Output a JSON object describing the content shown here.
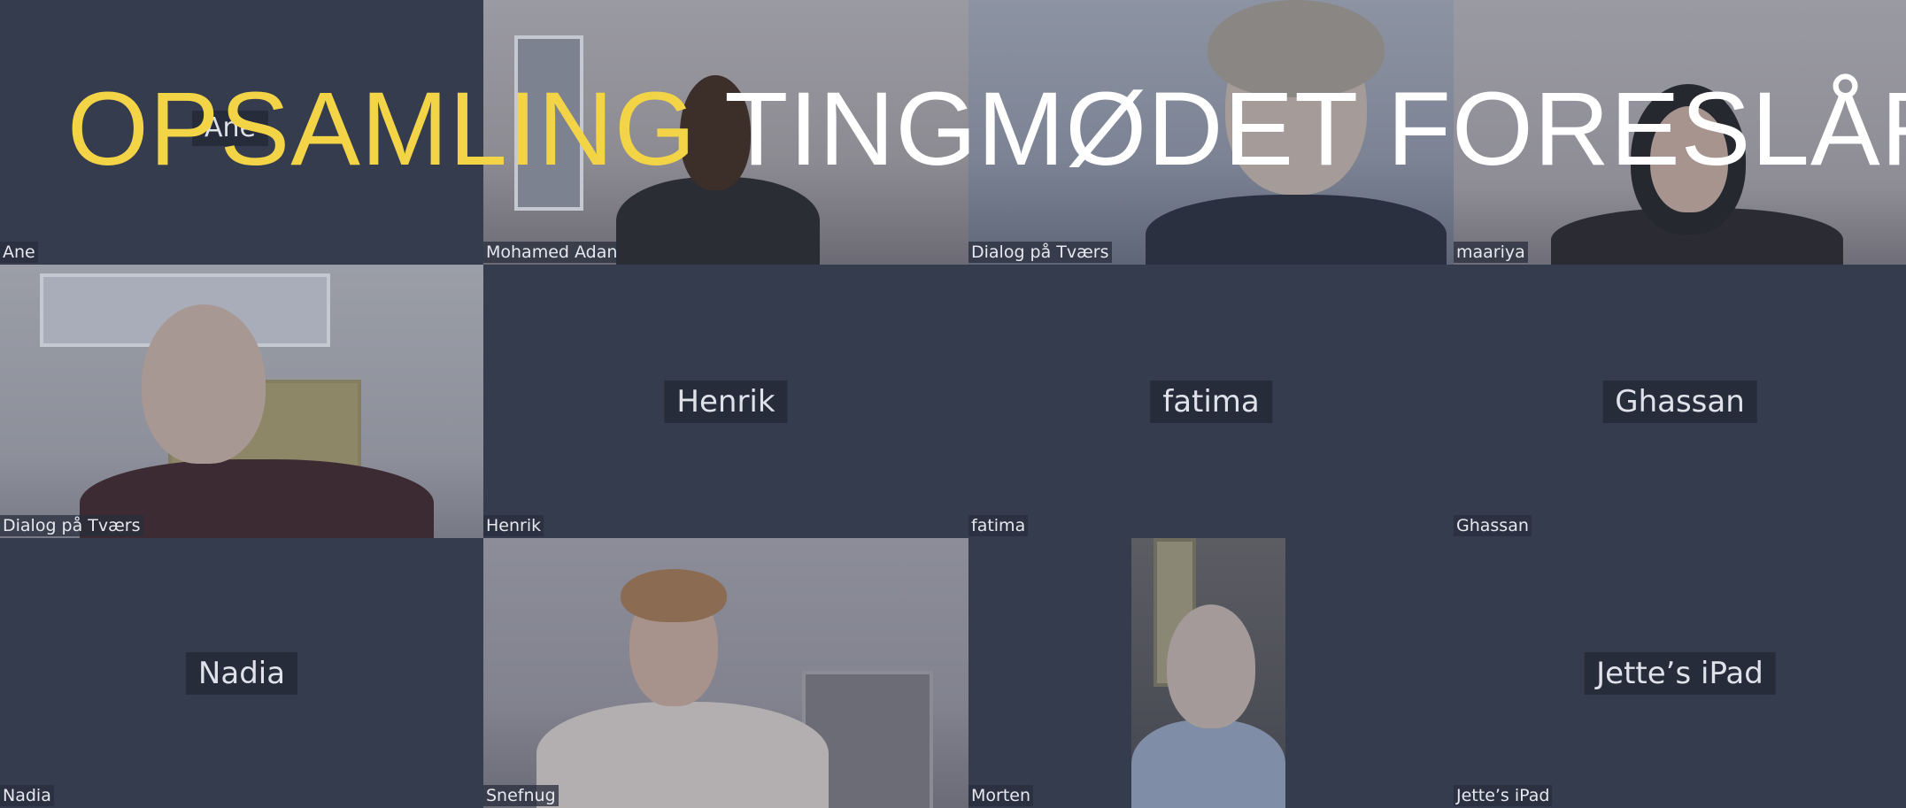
{
  "title": {
    "accent": "OPSAMLING",
    "main": "TINGMØDET FORESLÅR"
  },
  "colors": {
    "background": "#343c4e",
    "accent": "#f3d447",
    "title_text": "#ffffff",
    "name_chip": "#262c3a"
  },
  "tiles": [
    {
      "caption": "Ane",
      "center_label": "Ane",
      "video": false
    },
    {
      "caption": "Mohamed Adan",
      "center_label": "",
      "video": true
    },
    {
      "caption": "Dialog på Tværs",
      "center_label": "",
      "video": true
    },
    {
      "caption": "maariya",
      "center_label": "",
      "video": true
    },
    {
      "caption": "Dialog på Tværs",
      "center_label": "",
      "video": true
    },
    {
      "caption": "Henrik",
      "center_label": "Henrik",
      "video": false
    },
    {
      "caption": "fatima",
      "center_label": "fatima",
      "video": false
    },
    {
      "caption": "Ghassan",
      "center_label": "Ghassan",
      "video": false
    },
    {
      "caption": "Nadia",
      "center_label": "Nadia",
      "video": false
    },
    {
      "caption": "Snefnug",
      "center_label": "",
      "video": true
    },
    {
      "caption": "Morten",
      "center_label": "",
      "video": true
    },
    {
      "caption": "Jette’s iPad",
      "center_label": "Jette’s iPad",
      "video": false
    }
  ]
}
